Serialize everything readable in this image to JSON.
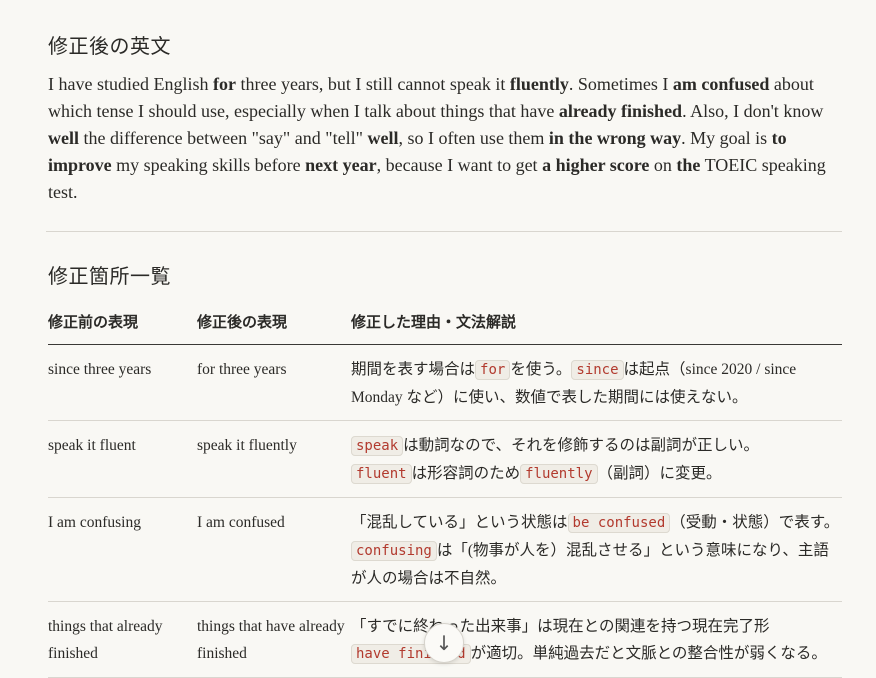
{
  "section1": {
    "title": "修正後の英文",
    "segments": [
      {
        "t": "I have studied English "
      },
      {
        "t": "for",
        "b": true
      },
      {
        "t": " three years, but I still cannot speak it "
      },
      {
        "t": "fluently",
        "b": true
      },
      {
        "t": ". Sometimes I "
      },
      {
        "t": "am confused",
        "b": true
      },
      {
        "t": " about which tense I should use, especially when I talk about things that have "
      },
      {
        "t": "already finished",
        "b": true
      },
      {
        "t": ". Also, I don't know "
      },
      {
        "t": "well",
        "b": true
      },
      {
        "t": " the difference between \"say\" and \"tell\" "
      },
      {
        "t": "well",
        "b": true
      },
      {
        "t": ", so I often use them "
      },
      {
        "t": "in the wrong way",
        "b": true
      },
      {
        "t": ". My goal is "
      },
      {
        "t": "to improve",
        "b": true
      },
      {
        "t": " my speaking skills before "
      },
      {
        "t": "next year",
        "b": true
      },
      {
        "t": ", because I want to get "
      },
      {
        "t": "a higher score",
        "b": true
      },
      {
        "t": " on "
      },
      {
        "t": "the",
        "b": true
      },
      {
        "t": " TOEIC speaking test."
      }
    ]
  },
  "section2": {
    "title": "修正箇所一覧",
    "headers": [
      "修正前の表現",
      "修正後の表現",
      "修正した理由・文法解説"
    ],
    "rows": [
      {
        "before": "since three years",
        "after": "for three years",
        "reason": [
          {
            "t": "期間を表す場合は"
          },
          {
            "c": "for"
          },
          {
            "t": "を使う。"
          },
          {
            "c": "since"
          },
          {
            "t": "は起点（since 2020 / since Monday など）に使い、数値で表した期間には使えない。"
          }
        ]
      },
      {
        "before": "speak it fluent",
        "after": "speak it fluently",
        "reason": [
          {
            "c": "speak"
          },
          {
            "t": "は動詞なので、それを修飾するのは副詞が正しい。"
          },
          {
            "br": true
          },
          {
            "c": "fluent"
          },
          {
            "t": "は形容詞のため"
          },
          {
            "c": "fluently"
          },
          {
            "t": "（副詞）に変更。"
          }
        ]
      },
      {
        "before": "I am confusing",
        "after": "I am confused",
        "reason": [
          {
            "t": "「混乱している」という状態は"
          },
          {
            "c": "be confused"
          },
          {
            "t": "（受動・状態）で表す。"
          },
          {
            "c": "confusing"
          },
          {
            "t": "は「(物事が人を）混乱させる」という意味になり、主語が人の場合は不自然。"
          }
        ]
      },
      {
        "before": "things that already finished",
        "after": "things that have already finished",
        "reason": [
          {
            "t": "「すでに終わった出来事」は現在との関連を持つ現在完了形"
          },
          {
            "br": true
          },
          {
            "c": "have finished"
          },
          {
            "t": "が適切。単純過去だと文脈との整合性が弱くなる。"
          }
        ]
      }
    ]
  },
  "scroll_button": {
    "icon": "arrow-down-icon",
    "glyph": "↓"
  }
}
